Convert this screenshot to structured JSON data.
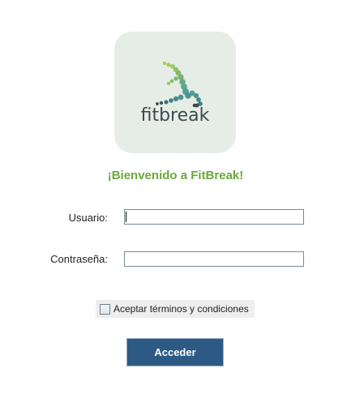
{
  "logo": {
    "wordmark": "fitbreak",
    "icon": "fitbreak-runner-icon",
    "colors": {
      "tile": "#e5ede6",
      "light_green": "#a6cc5a",
      "teal": "#56a992",
      "dark": "#3d4a4e"
    }
  },
  "welcome": {
    "text": "¡Bienvenido a FitBreak!",
    "color": "#6aa83a"
  },
  "form": {
    "username_label": "Usuario:",
    "username_value": "",
    "password_label": "Contraseña:",
    "password_value": "",
    "terms_label": "Aceptar términos y condiciones",
    "terms_checked": false,
    "submit_label": "Acceder",
    "submit_color": "#2d5a84"
  }
}
